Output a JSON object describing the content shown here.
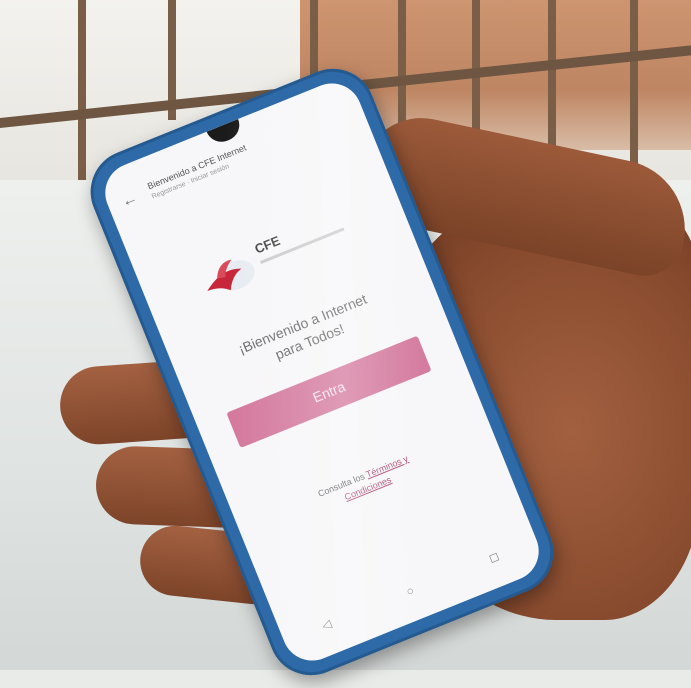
{
  "app": {
    "title": "Bienvenido a CFE Internet",
    "subtitle": "Registrarse · Iniciar sesión"
  },
  "logo": {
    "text": "CFE"
  },
  "welcome": {
    "line1": "¡Bienvenido a Internet",
    "line2": "para Todos!"
  },
  "enter_button": {
    "label": "Entra"
  },
  "terms": {
    "prefix": "Consulta los",
    "link_part1": "Términos y",
    "link_part2": "Condiciones"
  },
  "navbar": {
    "back": "◁",
    "home": "○",
    "recents": "◻"
  },
  "colors": {
    "case": "#2e6aa8",
    "button": "#d47a9e",
    "screen": "#f7f6f8",
    "skin": "#8a4c2f"
  }
}
